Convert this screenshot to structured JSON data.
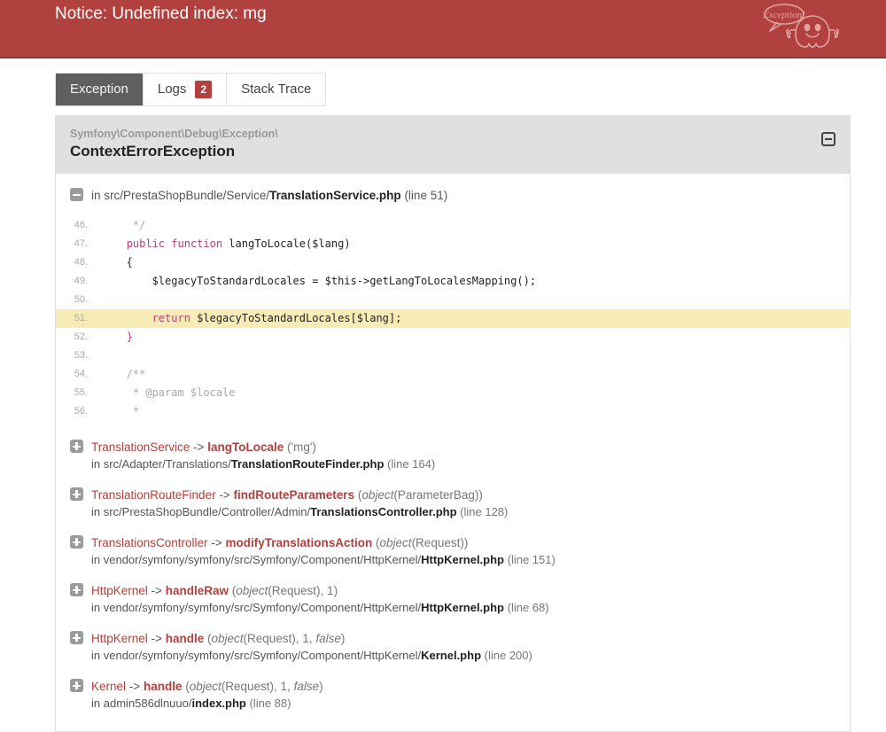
{
  "header": {
    "message": "Notice: Undefined index: mg",
    "logo_label": "Exception!",
    "logo_name": "symfony-ghost-logo",
    "bg_color": "#b0413e"
  },
  "tabs": [
    {
      "label": "Exception",
      "active": true,
      "badge": null
    },
    {
      "label": "Logs",
      "active": false,
      "badge": "2"
    },
    {
      "label": "Stack Trace",
      "active": false,
      "badge": null
    }
  ],
  "exception": {
    "namespace": "Symfony\\Component\\Debug\\Exception\\",
    "class": "ContextErrorException",
    "collapse_icon": "minus-square-icon"
  },
  "primary_frame": {
    "prefix": "in ",
    "path": "src/PrestaShopBundle/Service/",
    "file": "TranslationService.php",
    "line": "(line 51)"
  },
  "code": {
    "lines": [
      {
        "num": "46.",
        "text": "    */",
        "highlight": false,
        "tokens": [
          {
            "t": "    */",
            "c": "cm"
          }
        ]
      },
      {
        "num": "47.",
        "text": "   public function langToLocale($lang)",
        "highlight": false,
        "tokens": [
          {
            "t": "   ",
            "c": ""
          },
          {
            "t": "public",
            "c": "k"
          },
          {
            "t": " ",
            "c": ""
          },
          {
            "t": "function",
            "c": "k"
          },
          {
            "t": " langToLocale($lang)",
            "c": ""
          }
        ]
      },
      {
        "num": "48.",
        "text": "   {",
        "highlight": false,
        "tokens": [
          {
            "t": "   {",
            "c": ""
          }
        ]
      },
      {
        "num": "49.",
        "text": "       $legacyToStandardLocales = $this->getLangToLocalesMapping();",
        "highlight": false,
        "tokens": [
          {
            "t": "       $legacyToStandardLocales = $this->getLangToLocalesMapping();",
            "c": ""
          }
        ]
      },
      {
        "num": "50.",
        "text": "",
        "highlight": false,
        "tokens": []
      },
      {
        "num": "51.",
        "text": "       return $legacyToStandardLocales[$lang];",
        "highlight": true,
        "tokens": [
          {
            "t": "       ",
            "c": ""
          },
          {
            "t": "return",
            "c": "k"
          },
          {
            "t": " $legacyToStandardLocales[$lang];",
            "c": ""
          }
        ]
      },
      {
        "num": "52.",
        "text": "   }",
        "highlight": false,
        "tokens": [
          {
            "t": "   ",
            "c": ""
          },
          {
            "t": "}",
            "c": "k"
          }
        ]
      },
      {
        "num": "53.",
        "text": "",
        "highlight": false,
        "tokens": []
      },
      {
        "num": "54.",
        "text": "   /**",
        "highlight": false,
        "tokens": [
          {
            "t": "   /**",
            "c": "cm"
          }
        ]
      },
      {
        "num": "55.",
        "text": "    * @param $locale",
        "highlight": false,
        "tokens": [
          {
            "t": "    * @param $locale",
            "c": "cm"
          }
        ]
      },
      {
        "num": "56.",
        "text": "    *",
        "highlight": false,
        "tokens": [
          {
            "t": "    *",
            "c": "cm"
          }
        ]
      }
    ]
  },
  "trace": [
    {
      "expand_icon": "plus-square-icon",
      "class": "TranslationService",
      "arrow": "->",
      "method": "langToLocale",
      "args_plain": "('mg')",
      "args": [
        {
          "t": "('",
          "i": false
        },
        {
          "t": "mg",
          "i": false
        },
        {
          "t": "')",
          "i": false
        }
      ],
      "file_prefix": "in ",
      "file_path": "src/Adapter/Translations/",
      "file_name": "TranslationRouteFinder.php",
      "file_line": "(line 164)"
    },
    {
      "expand_icon": "plus-square-icon",
      "class": "TranslationRouteFinder",
      "arrow": "->",
      "method": "findRouteParameters",
      "args_plain": "(object(ParameterBag))",
      "args": [
        {
          "t": "(",
          "i": false
        },
        {
          "t": "object",
          "i": true
        },
        {
          "t": "(ParameterBag))",
          "i": false
        }
      ],
      "file_prefix": "in ",
      "file_path": "src/PrestaShopBundle/Controller/Admin/",
      "file_name": "TranslationsController.php",
      "file_line": "(line 128)"
    },
    {
      "expand_icon": "plus-square-icon",
      "class": "TranslationsController",
      "arrow": "->",
      "method": "modifyTranslationsAction",
      "args_plain": "(object(Request))",
      "args": [
        {
          "t": "(",
          "i": false
        },
        {
          "t": "object",
          "i": true
        },
        {
          "t": "(Request))",
          "i": false
        }
      ],
      "file_prefix": "in ",
      "file_path": "vendor/symfony/symfony/src/Symfony/Component/HttpKernel/",
      "file_name": "HttpKernel.php",
      "file_line": "(line 151)"
    },
    {
      "expand_icon": "plus-square-icon",
      "class": "HttpKernel",
      "arrow": "->",
      "method": "handleRaw",
      "args_plain": "(object(Request), 1)",
      "args": [
        {
          "t": "(",
          "i": false
        },
        {
          "t": "object",
          "i": true
        },
        {
          "t": "(Request), 1)",
          "i": false
        }
      ],
      "file_prefix": "in ",
      "file_path": "vendor/symfony/symfony/src/Symfony/Component/HttpKernel/",
      "file_name": "HttpKernel.php",
      "file_line": "(line 68)"
    },
    {
      "expand_icon": "plus-square-icon",
      "class": "HttpKernel",
      "arrow": "->",
      "method": "handle",
      "args_plain": "(object(Request), 1, false)",
      "args": [
        {
          "t": "(",
          "i": false
        },
        {
          "t": "object",
          "i": true
        },
        {
          "t": "(Request), 1, ",
          "i": false
        },
        {
          "t": "false",
          "i": true
        },
        {
          "t": ")",
          "i": false
        }
      ],
      "file_prefix": "in ",
      "file_path": "vendor/symfony/symfony/src/Symfony/Component/HttpKernel/",
      "file_name": "Kernel.php",
      "file_line": "(line 200)"
    },
    {
      "expand_icon": "plus-square-icon",
      "class": "Kernel",
      "arrow": "->",
      "method": "handle",
      "args_plain": "(object(Request), 1, false)",
      "args": [
        {
          "t": "(",
          "i": false
        },
        {
          "t": "object",
          "i": true
        },
        {
          "t": "(Request), 1, ",
          "i": false
        },
        {
          "t": "false",
          "i": true
        },
        {
          "t": ")",
          "i": false
        }
      ],
      "file_prefix": "in ",
      "file_path": "admin586dlnuuo/",
      "file_name": "index.php",
      "file_line": "(line 88)"
    }
  ],
  "colors": {
    "brand_red": "#b0413e",
    "header_border": "#8d3634",
    "tab_active_bg": "#5f5f5f",
    "panel_head_bg": "#e0e0e0",
    "code_highlight": "#f7ecb5",
    "keyword": "#b5407b"
  }
}
